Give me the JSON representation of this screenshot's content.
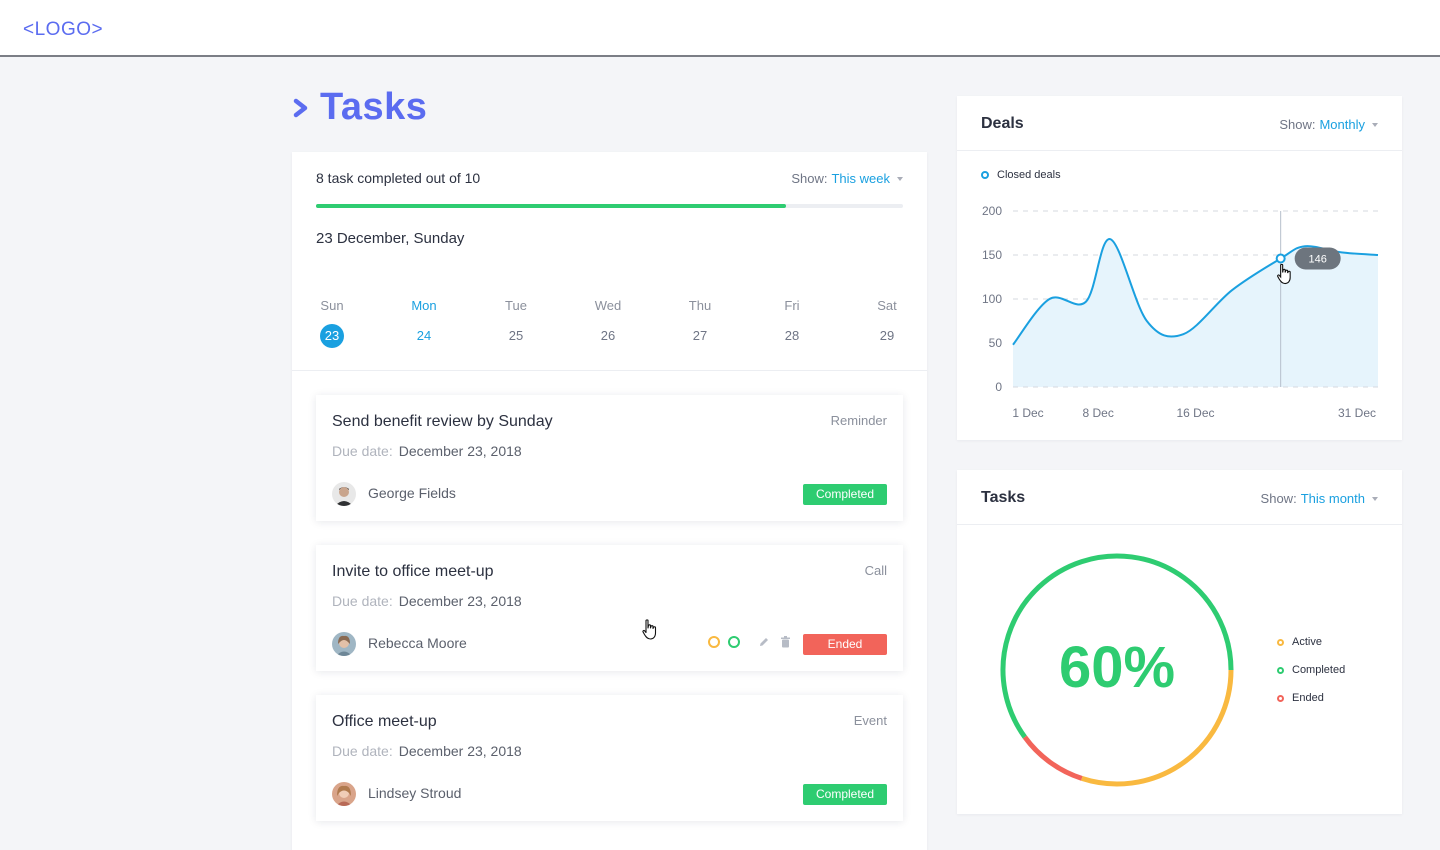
{
  "logo": "<LOGO>",
  "page_title": "Tasks",
  "tasks_panel": {
    "progress_text": "8 task completed out of 10",
    "progress": 0.8,
    "show_label": "Show:",
    "show_value": "This week",
    "date_title": "23 December, Sunday",
    "days": [
      {
        "name": "Sun",
        "num": "23",
        "state": "selected"
      },
      {
        "name": "Mon",
        "num": "24",
        "state": "today"
      },
      {
        "name": "Tue",
        "num": "25",
        "state": ""
      },
      {
        "name": "Wed",
        "num": "26",
        "state": ""
      },
      {
        "name": "Thu",
        "num": "27",
        "state": ""
      },
      {
        "name": "Fri",
        "num": "28",
        "state": ""
      },
      {
        "name": "Sat",
        "num": "29",
        "state": ""
      }
    ],
    "tasks": [
      {
        "title": "Send benefit review by Sunday",
        "category": "Reminder",
        "due_label": "Due date:",
        "due": "December 23, 2018",
        "person": "George Fields",
        "status": "Completed"
      },
      {
        "title": "Invite to office meet-up",
        "category": "Call",
        "due_label": "Due date:",
        "due": "December 23, 2018",
        "person": "Rebecca Moore",
        "status": "Ended"
      },
      {
        "title": "Office meet-up",
        "category": "Event",
        "due_label": "Due date:",
        "due": "December 23, 2018",
        "person": "Lindsey Stroud",
        "status": "Completed"
      }
    ]
  },
  "deals_panel": {
    "title": "Deals",
    "show_label": "Show:",
    "show_value": "Monthly",
    "tooltip": "146"
  },
  "tasks_chart_panel": {
    "title": "Tasks",
    "show_label": "Show:",
    "show_value": "This month",
    "percent_label": "60%",
    "legend": [
      {
        "label": "Active",
        "color": "#f9b940"
      },
      {
        "label": "Completed",
        "color": "#2ecc71"
      },
      {
        "label": "Ended",
        "color": "#f2645a"
      }
    ]
  },
  "colors": {
    "brand": "#5b6cf0",
    "accent": "#1aa0e0",
    "completed": "#2ecc71",
    "ended": "#f2645a",
    "active": "#f9b940"
  },
  "chart_data": [
    {
      "type": "area",
      "title": "Deals",
      "series": [
        {
          "name": "Closed deals",
          "x": [
            1,
            4,
            7,
            9,
            12,
            15,
            19,
            23,
            25,
            28,
            31
          ],
          "values": [
            48,
            100,
            97,
            168,
            75,
            60,
            110,
            146,
            160,
            153,
            150
          ]
        }
      ],
      "x_tick_labels": [
        "1 Dec",
        "8 Dec",
        "16 Dec",
        "31 Dec"
      ],
      "x_tick_values": [
        1,
        8,
        16,
        31
      ],
      "xlim": [
        1,
        31
      ],
      "ylim": [
        0,
        200
      ],
      "y_ticks": [
        0,
        50,
        100,
        150,
        200
      ],
      "grid": true,
      "legend": "top-left",
      "highlight": {
        "x": 23,
        "value": 146
      }
    },
    {
      "type": "pie",
      "title": "Tasks",
      "labels": [
        "Completed",
        "Active",
        "Ended"
      ],
      "values": [
        60,
        30,
        10
      ],
      "center_label": "60%"
    }
  ]
}
